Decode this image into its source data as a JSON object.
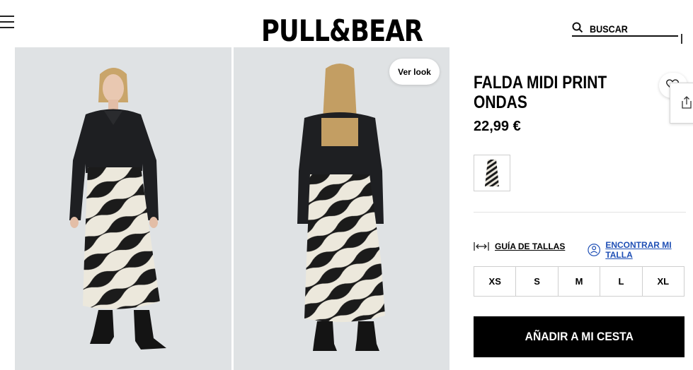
{
  "header": {
    "logo": "PULL&BEAR",
    "search_label": "BUSCAR"
  },
  "gallery": {
    "ver_look_label": "Ver look"
  },
  "product": {
    "title_line1": "FALDA MIDI PRINT",
    "title_line2": "ONDAS",
    "price": "22,99 €",
    "size_guide_label": "GUÍA DE TALLAS",
    "find_size_label": "ENCONTRAR MI TALLA",
    "sizes": [
      "XS",
      "S",
      "M",
      "L",
      "XL"
    ],
    "add_to_cart_label": "AÑADIR A MI CESTA"
  },
  "icons": {
    "menu": "hamburger-menu-icon",
    "search": "search-icon",
    "favorite": "heart-icon",
    "share": "share-icon",
    "size_guide": "ruler-icon",
    "find_size": "person-measure-icon"
  },
  "colors": {
    "accent_link": "#1f4fb5",
    "primary_button": "#000000",
    "photo_background": "#dfe2e4"
  }
}
